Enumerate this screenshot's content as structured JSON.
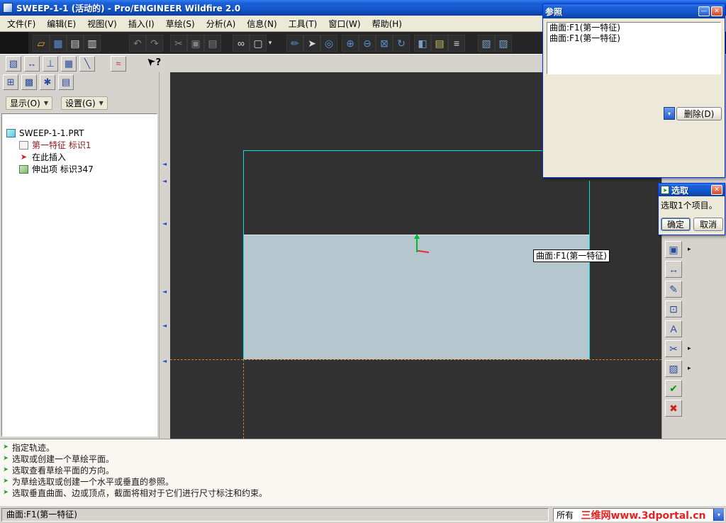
{
  "window": {
    "title": "SWEEP-1-1 (活动的) - Pro/ENGINEER Wildfire 2.0"
  },
  "menu": {
    "items": [
      "文件(F)",
      "编辑(E)",
      "视图(V)",
      "插入(I)",
      "草绘(S)",
      "分析(A)",
      "信息(N)",
      "工具(T)",
      "窗口(W)",
      "帮助(H)"
    ]
  },
  "toolbar_main": {
    "icons": [
      {
        "name": "open",
        "glyph": "▱"
      },
      {
        "name": "save",
        "glyph": "▦"
      },
      {
        "name": "print",
        "glyph": "▤"
      },
      {
        "name": "print-preview",
        "glyph": "▥"
      },
      {
        "name": "undo",
        "glyph": "↶"
      },
      {
        "name": "redo",
        "glyph": "↷"
      },
      {
        "name": "cut",
        "glyph": "✂"
      },
      {
        "name": "copy",
        "glyph": "▣"
      },
      {
        "name": "paste",
        "glyph": "▤"
      },
      {
        "name": "find",
        "glyph": "∞"
      },
      {
        "name": "select-box",
        "glyph": "▢"
      },
      {
        "name": "sketch-plane",
        "glyph": "✏"
      },
      {
        "name": "pointer",
        "glyph": "➤"
      },
      {
        "name": "view-glasses",
        "glyph": "◎"
      },
      {
        "name": "zoom-in",
        "glyph": "⊕"
      },
      {
        "name": "zoom-out",
        "glyph": "⊖"
      },
      {
        "name": "zoom-fit",
        "glyph": "⊠"
      },
      {
        "name": "repaint",
        "glyph": "↻"
      },
      {
        "name": "shade",
        "glyph": "◧"
      },
      {
        "name": "layers",
        "glyph": "▤"
      },
      {
        "name": "environment",
        "glyph": "≡"
      },
      {
        "name": "view-manager",
        "glyph": "▧"
      },
      {
        "name": "model-box",
        "glyph": "▨"
      }
    ]
  },
  "toolbar_sketch": {
    "icons": [
      {
        "name": "sketch-orient",
        "glyph": "▧"
      },
      {
        "name": "horizontal-ref",
        "glyph": "↔"
      },
      {
        "name": "vertical-ref",
        "glyph": "⊥"
      },
      {
        "name": "grid",
        "glyph": "▦"
      },
      {
        "name": "diagonal-line",
        "glyph": "╲"
      },
      {
        "name": "line-style",
        "glyph": "≈"
      }
    ]
  },
  "tree_toolbar": {
    "icons": [
      {
        "name": "model-tree-toggle",
        "glyph": "⊞"
      },
      {
        "name": "folder-browser",
        "glyph": "▩"
      },
      {
        "name": "favorites",
        "glyph": "✱"
      },
      {
        "name": "layer-tree",
        "glyph": "▤"
      }
    ]
  },
  "model_tree": {
    "show_button": "显示(O)",
    "settings_button": "设置(G)",
    "items": [
      {
        "label": "SWEEP-1-1.PRT",
        "icon": "part-icon"
      },
      {
        "label": "第一特征 标识1",
        "icon": "feature-icon"
      },
      {
        "label": "在此插入",
        "icon": "insert-here-icon"
      },
      {
        "label": "伸出项 标识347",
        "icon": "protrusion-icon"
      }
    ]
  },
  "canvas": {
    "tooltip": "曲面:F1(第一特征)"
  },
  "right_toolbar": {
    "items": [
      {
        "name": "select-tool",
        "glyph": "▣",
        "flyout": true
      },
      {
        "name": "modify-tool",
        "glyph": "↔",
        "flyout": false
      },
      {
        "name": "spline-tool",
        "glyph": "✎",
        "flyout": false
      },
      {
        "name": "mirror-tool",
        "glyph": "⊡",
        "flyout": false
      },
      {
        "name": "text-tool",
        "glyph": "A",
        "flyout": false
      },
      {
        "name": "trim-tool",
        "glyph": "✂",
        "flyout": true
      },
      {
        "name": "pattern-tool",
        "glyph": "▨",
        "flyout": true
      },
      {
        "name": "done",
        "glyph": "✔",
        "flyout": false
      },
      {
        "name": "quit",
        "glyph": "✖",
        "flyout": false
      }
    ]
  },
  "ref_dialog": {
    "title": "参照",
    "list": [
      "曲面:F1(第一特征)",
      "曲面:F1(第一特征)"
    ],
    "delete_button": "删除(D)"
  },
  "select_dialog": {
    "title": "选取",
    "message": "选取1个项目。",
    "ok": "确定",
    "cancel": "取消"
  },
  "messages": {
    "lines": [
      "指定轨迹。",
      "选取或创建一个草绘平面。",
      "选取查看草绘平面的方向。",
      "为草绘选取或创建一个水平或垂直的参照。",
      "选取垂直曲面、边或顶点，截面将相对于它们进行尺寸标注和约束。"
    ]
  },
  "status_bar": {
    "selection": "曲面:F1(第一特征)",
    "filter": "所有",
    "watermark": "三维网www.3dportal.cn"
  },
  "icons": {
    "dropdown_arrow": "▼",
    "combo_arrow": "▾",
    "flyout_arrow": "▸",
    "splitter_arrow": "◄",
    "cursor_arrow": "➤",
    "cursor_question": "?",
    "prompt_arrow": "➤",
    "insert_arrow": "➤",
    "close": "✕",
    "minimize": "—"
  },
  "colors": {
    "sketch_line": "#00e0e0",
    "surface_fill": "#b6c6ce",
    "centerline": "#e07820",
    "done_green": "#009900",
    "quit_red": "#cc2222",
    "watermark_red": "#e82020"
  }
}
